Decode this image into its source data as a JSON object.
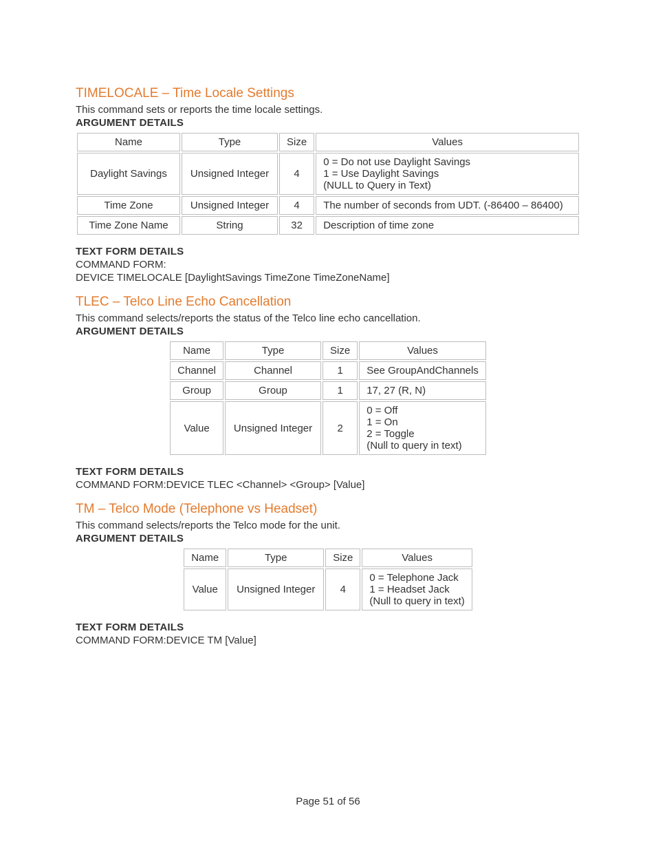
{
  "sections": [
    {
      "title": "TIMELOCALE – Time Locale Settings",
      "desc": "This command sets or reports the time locale settings.",
      "arg_details_label": "ARGUMENT DETAILS",
      "table_headers": {
        "name": "Name",
        "type": "Type",
        "size": "Size",
        "values": "Values"
      },
      "rows": [
        {
          "name": "Daylight Savings",
          "type": "Unsigned Integer",
          "size": "4",
          "values": "0 = Do not use Daylight Savings\n1 = Use Daylight Savings\n(NULL to Query in Text)"
        },
        {
          "name": "Time Zone",
          "type": "Unsigned Integer",
          "size": "4",
          "values": "The number of seconds from UDT. (-86400 – 86400)"
        },
        {
          "name": "Time Zone Name",
          "type": "String",
          "size": "32",
          "values": "Description of time zone"
        }
      ],
      "text_form_label": "TEXT FORM DETAILS",
      "command_form_label": "COMMAND FORM:",
      "command_form": "DEVICE TIMELOCALE [DaylightSavings TimeZone TimeZoneName]"
    },
    {
      "title": "TLEC – Telco Line Echo Cancellation",
      "desc": "This command selects/reports the status of the Telco line echo cancellation.",
      "arg_details_label": "ARGUMENT DETAILS",
      "table_headers": {
        "name": "Name",
        "type": "Type",
        "size": "Size",
        "values": "Values"
      },
      "rows": [
        {
          "name": "Channel",
          "type": "Channel",
          "size": "1",
          "values": "See GroupAndChannels"
        },
        {
          "name": "Group",
          "type": "Group",
          "size": "1",
          "values": "17, 27 (R, N)"
        },
        {
          "name": "Value",
          "type": "Unsigned Integer",
          "size": "2",
          "values": "0 = Off\n1 = On\n2 = Toggle\n(Null to query in text)"
        }
      ],
      "text_form_label": "TEXT FORM DETAILS",
      "command_form_label": "COMMAND FORM:",
      "command_form": "DEVICE TLEC <Channel> <Group> [Value]"
    },
    {
      "title": "TM – Telco Mode (Telephone vs Headset)",
      "desc": "This command selects/reports the Telco mode for the unit.",
      "arg_details_label": "ARGUMENT DETAILS",
      "table_headers": {
        "name": "Name",
        "type": "Type",
        "size": "Size",
        "values": "Values"
      },
      "rows": [
        {
          "name": "Value",
          "type": "Unsigned Integer",
          "size": "4",
          "values": "0 = Telephone Jack\n1 = Headset Jack\n(Null to query in text)"
        }
      ],
      "text_form_label": "TEXT FORM DETAILS",
      "command_form_label": "COMMAND FORM:",
      "command_form": "DEVICE TM [Value]"
    }
  ],
  "footer": "Page 51 of 56"
}
